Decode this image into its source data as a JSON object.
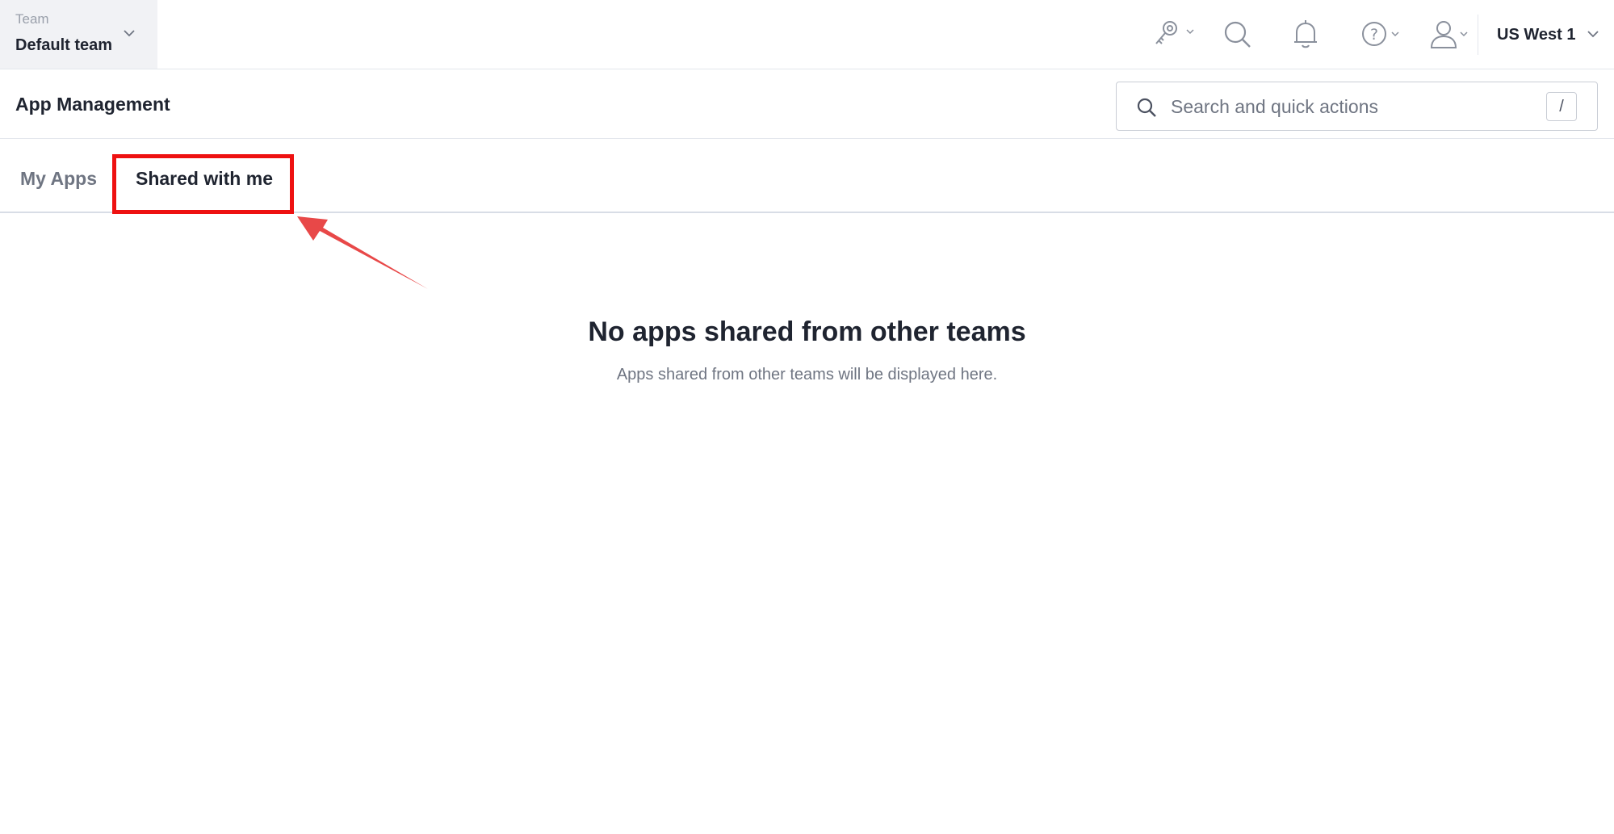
{
  "team": {
    "label": "Team",
    "name": "Default team"
  },
  "topbar": {
    "icons": [
      "key-icon",
      "search-icon",
      "bell-icon",
      "help-icon",
      "user-icon"
    ],
    "region": "US West 1"
  },
  "header": {
    "title": "App Management",
    "search": {
      "placeholder": "Search and quick actions",
      "shortcut": "/"
    }
  },
  "tabs": [
    {
      "label": "My Apps",
      "active": false
    },
    {
      "label": "Shared with me",
      "active": true
    }
  ],
  "empty_state": {
    "title": "No apps shared from other teams",
    "subtitle": "Apps shared from other teams will be displayed here."
  },
  "colors": {
    "annotation": "#ee1111",
    "arrow": "#e84848",
    "text_primary": "#1f2430",
    "text_muted": "#6f7582"
  }
}
